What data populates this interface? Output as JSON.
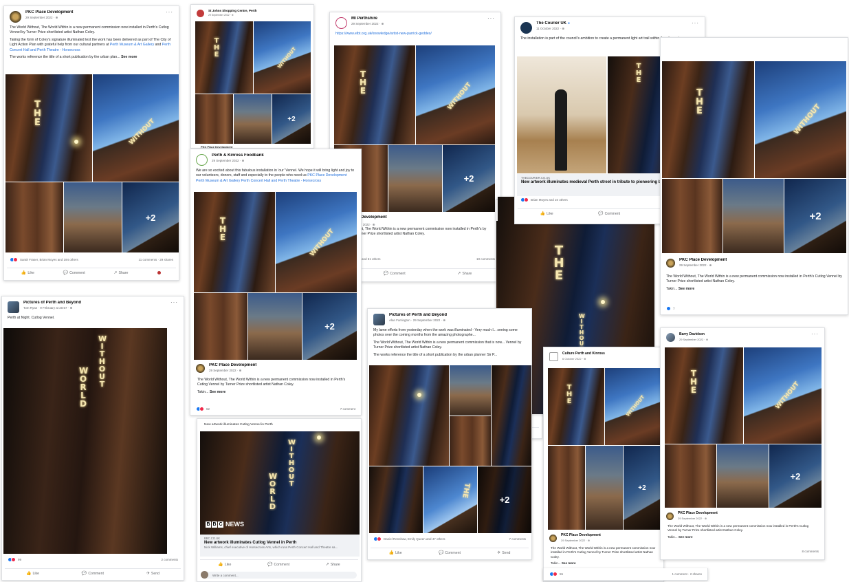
{
  "posts": [
    {
      "author": "PKC Place Development",
      "date": "29 September 2022 · ⊕",
      "p1": "The World Without, The World Within is a new permanent commission now installed in Perth's Cutlog Vennel by Turner Prize shortlisted artist Nathan Coley.",
      "p2a": "Taking the form of Coley's signature illuminated text the work has been delivered as part of The City of Light Action Plan with grateful help from our cultural partners at ",
      "p2b": "Perth Museum & Art Gallery",
      "p2c": " and ",
      "p2d": "Perth Concert Hall and Perth Theatre - Horsecross",
      "p3": "The works reference the title of a short publication by the urban plan...",
      "see_more": "See more",
      "reactions": "Sarah Fraser, Brian Moyes and 194 others",
      "meta": "11 comments · 29 shares",
      "plus": "+2"
    },
    {
      "author": "St Johns Shopping Centre, Perth",
      "date": "29 September 2022 · ⊕",
      "plus": "+2",
      "footer": "PKC Place Development"
    },
    {
      "author": "MI Perthshire",
      "date": "29 September 2022 · ⊕",
      "url": "https://www.elbt.org.uk/knowledge/artist-new-parrick-geddes/",
      "plus": "+2",
      "shared": "e Development",
      "shared_date": "ber 2022 · ⊕",
      "text": "hout, The World Within is a new permanent commission now installed in Perth's by Turner Prize shortlisted artist Nathan Coley.",
      "reactions": "es and 51 others",
      "meta": "10 comments"
    },
    {
      "author": "The Courier UK",
      "date": "11 October 2022 · ⊕",
      "text": "The installation is part of the council's ambition to create a permanent light art trail within the city centre.",
      "domain": "THECOURIER.CO.UK",
      "title": "New artwork illuminates medieval Perth street in tribute to pioneering biologist",
      "reactions": "Brian Moyes and 10 others",
      "meta": "1 comment"
    },
    {
      "author": "PKC Place Development",
      "date": "29 September 2022 · ⊕",
      "text": "The World Without, The World Within is a new permanent commission now installed in Perth's Cutlog Vennel by Turner Prize shortlisted artist Nathan Coley.",
      "takin": "Takin... ",
      "see_more": "See more",
      "reactions": "7",
      "plus": "+2"
    },
    {
      "author": "Pictures of Perth and Beyond",
      "date": "Tom Ryan · 9 February at 20:57 · ⊕",
      "text": "Perth at Night. Cutlog Vennel.",
      "reactions": "99",
      "meta": "2 comments",
      "sign1": "WORLD",
      "sign2": "WITHOUT"
    },
    {
      "author": "Perth & Kinross Foodbank",
      "date": "29 September 2022 · ⊕",
      "text_a": "We are so excited about this fabulous installation in 'our' Vennel. We hope it will bring light and joy to our volunteers, donors, staff and especially to the people who need us ",
      "text_b": "PKC Place Development Perth Museum & Art Gallery Perth Concert Hall and Perth Theatre - Horsecross",
      "shared": "PKC Place Development",
      "shared_date": "29 September 2022 · ⊕",
      "text2": "The World Without, The World Within is a new permanent commission now installed in Perth's Cutlog Vennel by Turner Prize shortlisted artist Nathan Coley.",
      "takin": "Takin... ",
      "see_more": "See more",
      "reactions": "62",
      "meta": "7 comment",
      "plus": "+2"
    },
    {
      "header": "New artwork illuminates Cutlog Vennel in Perth",
      "domain": "BBC.CO.UK",
      "title": "New artwork illuminates Cutlog Vennel in Perth",
      "desc": "Nick Williams, chief executive of Horsecross Arts, which runs Perth Concert Hall and Theatre sa...",
      "comment_ph": "Write a comment...",
      "sign1": "WORLD",
      "sign2": "WITHOUT",
      "bbc_n": "NEWS"
    },
    {
      "author": "Pictures of Perth and Beyond",
      "date": "Alan Farrington · 29 September 2022 · ⊕",
      "text1": "My lame efforts from yesterday when the work was illuminated - Very much l... seeing some photos over the coming months from the amazing photographe...",
      "text2": "The World Without, The World Within is a new permanent commission that is now... Vennel by Turner Prize shortlisted artist Nathan Coley.",
      "text3": "The works reference the title of a short publication by the urban planner Sir P...",
      "reactions": "Daniel Renshaw, Emily Queen and 47 others",
      "meta": "7 comments",
      "plus": "+2"
    },
    {
      "author": "Culture Perth and Kinross",
      "date": "6 October 2022 · ⊕",
      "shared": "PKC Place Development",
      "shared_date": "29 September 2022 · ⊕",
      "text": "The World Without, The World Within is a new permanent commission now installed in Perth's Cutlog Vennel by Turner Prize shortlisted artist Nathan Coley.",
      "takin": "Takin... ",
      "see_more": "See more",
      "reactions": "55",
      "meta": "1 comment · 2 shares",
      "plus": "+2"
    },
    {
      "author": "Barry Davidson",
      "date": "29 September 2022 · ⊕",
      "shared": "PKC Place Development",
      "shared_date": "29 September 2022 · ⊕",
      "text": "The World Without, The World Within is a new permanent commission now installed in Perth's Cutlog Vennel by Turner Prize shortlisted artist Nathan Coley.",
      "takin": "Takin... ",
      "see_more": "See more",
      "meta": "8 comments",
      "plus": "+2"
    },
    {
      "reactions": "46"
    }
  ],
  "actions": {
    "like": "Like",
    "comment": "Comment",
    "share": "Share",
    "send": "Send"
  },
  "sign_the": "THE",
  "sign_without": "WITHOUT",
  "sign_world": "WORLD",
  "sign_without2": "WITHOUT",
  "more_dots": "···",
  "icons": {
    "like": "👍",
    "comment": "💬",
    "share": "↗",
    "send": "✈"
  },
  "colors": {
    "facebook_blue": "#1877f2",
    "love_red": "#f02849",
    "link_blue": "#216fdb"
  }
}
